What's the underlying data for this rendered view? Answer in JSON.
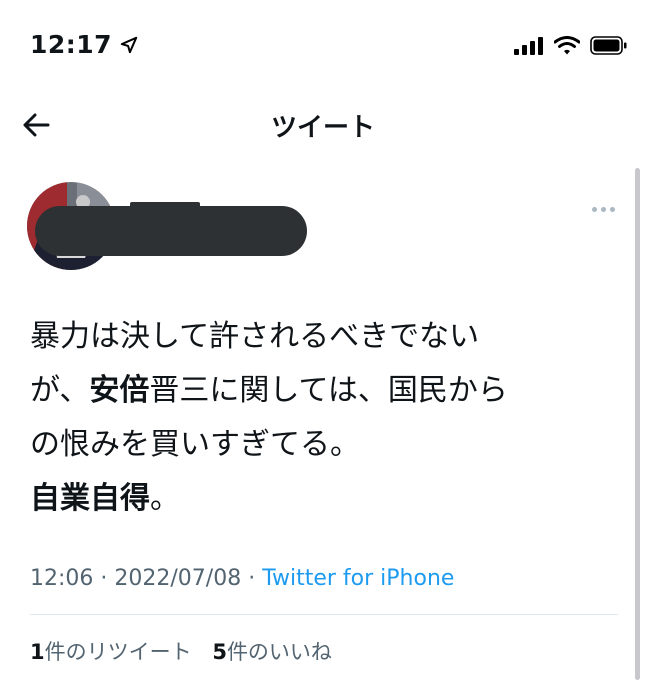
{
  "status_bar": {
    "time": "12:17",
    "icons": [
      "location-arrow-icon",
      "cellular-signal-icon",
      "wifi-icon",
      "battery-icon"
    ]
  },
  "header": {
    "title": "ツイート",
    "back_icon": "back-arrow-icon"
  },
  "tweet": {
    "user": {
      "display_name_redacted": true
    },
    "more_icon": "more-options-icon",
    "text": {
      "line1": "暴力は決して許されるべきでない",
      "line2_pre": "が、",
      "line2_bold": "安倍",
      "line2_post": "晋三に関しては、国民から",
      "line3": "の恨みを買いすぎてる。",
      "line4_bold": "自業自得",
      "line4_post": "。"
    },
    "time": "12:06",
    "separator": " · ",
    "date": "2022/07/08",
    "source": "Twitter for iPhone",
    "retweets": {
      "count": "1",
      "label": "件のリツイート"
    },
    "likes": {
      "count": "5",
      "label": "件のいいね"
    }
  },
  "colors": {
    "text": "#0f1419",
    "muted": "#536471",
    "link": "#1d9bf0",
    "redaction": "#2e3133"
  }
}
